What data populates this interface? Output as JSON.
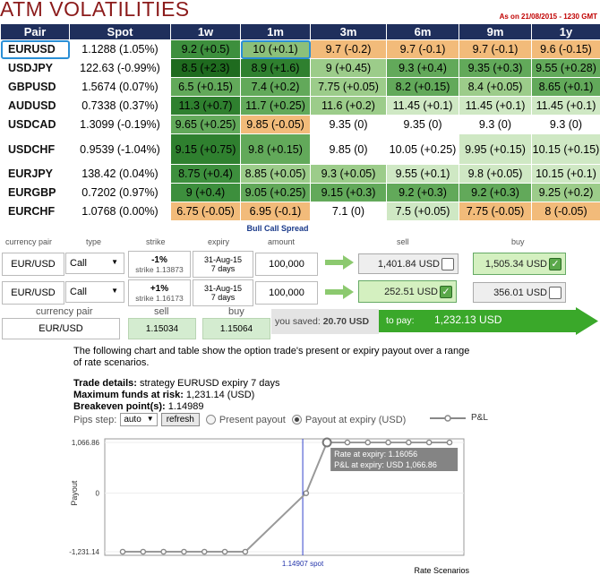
{
  "header": {
    "title": "ATM VOLATILITIES",
    "as_of": "As on 21/08/2015 - 1230 GMT"
  },
  "vol_table": {
    "columns": [
      "Pair",
      "Spot",
      "1w",
      "1m",
      "3m",
      "6m",
      "9m",
      "1y"
    ],
    "rows": [
      {
        "pair": "EURUSD",
        "spot": "1.1288 (1.05%)",
        "cells": [
          "9.2 (+0.5)",
          "10 (+0.1)",
          "9.7 (-0.2)",
          "9.7 (-0.1)",
          "9.7 (-0.1)",
          "9.6 (-0.15)"
        ]
      },
      {
        "pair": "USDJPY",
        "spot": "122.63 (-0.99%)",
        "cells": [
          "8.5 (+2.3)",
          "8.9 (+1.6)",
          "9 (+0.45)",
          "9.3 (+0.4)",
          "9.35 (+0.3)",
          "9.55 (+0.28)"
        ]
      },
      {
        "pair": "GBPUSD",
        "spot": "1.5674 (0.07%)",
        "cells": [
          "6.5 (+0.15)",
          "7.4 (+0.2)",
          "7.75 (+0.05)",
          "8.2 (+0.15)",
          "8.4 (+0.05)",
          "8.65 (+0.1)"
        ]
      },
      {
        "pair": "AUDUSD",
        "spot": "0.7338 (0.37%)",
        "cells": [
          "11.3 (+0.7)",
          "11.7 (+0.25)",
          "11.6 (+0.2)",
          "11.45 (+0.1)",
          "11.45 (+0.1)",
          "11.45 (+0.1)"
        ]
      },
      {
        "pair": "USDCAD",
        "spot": "1.3099 (-0.19%)",
        "cells": [
          "9.65 (+0.25)",
          "9.85 (-0.05)",
          "9.35 (0)",
          "9.35 (0)",
          "9.3 (0)",
          "9.3 (0)"
        ]
      },
      {
        "pair": "USDCHF",
        "spot": "0.9539 (-1.04%)",
        "cells": [
          "9.15 (+0.75)",
          "9.8 (+0.15)",
          "9.85 (0)",
          "10.05 (+0.25)",
          "9.95 (+0.15)",
          "10.15 (+0.15)"
        ]
      },
      {
        "pair": "EURJPY",
        "spot": "138.42 (0.04%)",
        "cells": [
          "8.75 (+0.4)",
          "8.85 (+0.05)",
          "9.3 (+0.05)",
          "9.55 (+0.1)",
          "9.8 (+0.05)",
          "10.15 (+0.1)"
        ]
      },
      {
        "pair": "EURGBP",
        "spot": "0.7202 (0.97%)",
        "cells": [
          "9 (+0.4)",
          "9.05 (+0.25)",
          "9.15 (+0.3)",
          "9.2 (+0.3)",
          "9.2 (+0.3)",
          "9.25 (+0.2)"
        ]
      },
      {
        "pair": "EURCHF",
        "spot": "1.0768 (0.00%)",
        "cells": [
          "6.75 (-0.05)",
          "6.95 (-0.1)",
          "7.1 (0)",
          "7.5 (+0.05)",
          "7.75 (-0.05)",
          "8 (-0.05)"
        ]
      }
    ],
    "colors": [
      [
        "#3d8f3d",
        "#8cc07a",
        "#f2bb7a",
        "#f2bb7a",
        "#f2bb7a",
        "#f2bb7a"
      ],
      [
        "#1f6b1f",
        "#2f802f",
        "#9ccc8a",
        "#62a95a",
        "#62a95a",
        "#62a95a"
      ],
      [
        "#62a95a",
        "#62a95a",
        "#9ccc8a",
        "#62a95a",
        "#9ccc8a",
        "#62a95a"
      ],
      [
        "#2f802f",
        "#62a95a",
        "#9ccc8a",
        "#cfe8c4",
        "#cfe8c4",
        "#cfe8c4"
      ],
      [
        "#62a95a",
        "#f2bb7a",
        "#ffffff",
        "#ffffff",
        "#ffffff",
        "#ffffff"
      ],
      [
        "#2f802f",
        "#62a95a",
        "#ffffff",
        "#ffffff",
        "#cfe8c4",
        "#cfe8c4"
      ],
      [
        "#3d8f3d",
        "#9ccc8a",
        "#9ccc8a",
        "#cfe8c4",
        "#cfe8c4",
        "#cfe8c4"
      ],
      [
        "#3d8f3d",
        "#62a95a",
        "#62a95a",
        "#62a95a",
        "#62a95a",
        "#9ccc8a"
      ],
      [
        "#f2bb7a",
        "#f2bb7a",
        "#ffffff",
        "#cfe8c4",
        "#f2bb7a",
        "#f2bb7a"
      ]
    ]
  },
  "spread": {
    "title": "Bull Call Spread",
    "col_labels": {
      "pair": "currency pair",
      "type": "type",
      "strike": "strike",
      "expiry": "expiry",
      "amount": "amount",
      "sell": "sell",
      "buy": "buy"
    },
    "legs": [
      {
        "pair": "EUR/USD",
        "type": "Call",
        "strike_pct": "-1%",
        "strike_sub": "strike 1.13873",
        "expiry_date": "31-Aug-15",
        "expiry_days": "7 days",
        "amount": "100,000",
        "sell": "1,401.84 USD",
        "buy": "1,505.34 USD",
        "selected": "buy"
      },
      {
        "pair": "EUR/USD",
        "type": "Call",
        "strike_pct": "+1%",
        "strike_sub": "strike 1.16173",
        "expiry_date": "31-Aug-15",
        "expiry_days": "7 days",
        "amount": "100,000",
        "sell": "252.51 USD",
        "buy": "356.01 USD",
        "selected": "sell"
      }
    ],
    "summary": {
      "pair_label": "currency pair",
      "pair": "EUR/USD",
      "sell_label": "sell",
      "sell": "1.15034",
      "buy_label": "buy",
      "buy": "1.15064",
      "saved_label": "you saved:",
      "saved": "20.70 USD",
      "topay_label": "to pay:",
      "topay": "1,232.13 USD"
    }
  },
  "description": {
    "intro": "The following chart and table show the option trade's present or expiry payout over a range of rate scenarios.",
    "trade_details_label": "Trade details:",
    "trade_details": " strategy EURUSD expiry 7 days",
    "max_funds_label": "Maximum funds at risk:",
    "max_funds": " 1,231.14 (USD)",
    "breakeven_label": "Breakeven point(s):",
    "breakeven": " 1.14989"
  },
  "controls": {
    "pips_label": "Pips step:",
    "pips_value": "auto",
    "refresh": "refresh",
    "present": "Present payout",
    "expiry": "Payout at expiry (USD)",
    "legend": "P&L"
  },
  "chart_data": {
    "type": "line",
    "series": [
      {
        "name": "P&L",
        "x": [
          1.105,
          1.11,
          1.115,
          1.12,
          1.125,
          1.13,
          1.135,
          1.14989,
          1.155,
          1.16,
          1.165,
          1.17,
          1.175,
          1.18,
          1.185
        ],
        "values": [
          -1231.14,
          -1231.14,
          -1231.14,
          -1231.14,
          -1231.14,
          -1231.14,
          -1231.14,
          0,
          1066.86,
          1066.86,
          1066.86,
          1066.86,
          1066.86,
          1066.86,
          1066.86
        ]
      }
    ],
    "y_ticks": [
      "1,066.86",
      "0",
      "-1,231.14"
    ],
    "ylim": [
      -1231.14,
      1066.86
    ],
    "ylabel": "Payout",
    "xlabel": "Rate Scenarios",
    "spot_label": "1.14907 spot",
    "spot": 1.14907,
    "tooltip": {
      "line1": "Rate at expiry: 1.16056",
      "line2": "P&L at expiry: USD 1,066.86"
    }
  }
}
